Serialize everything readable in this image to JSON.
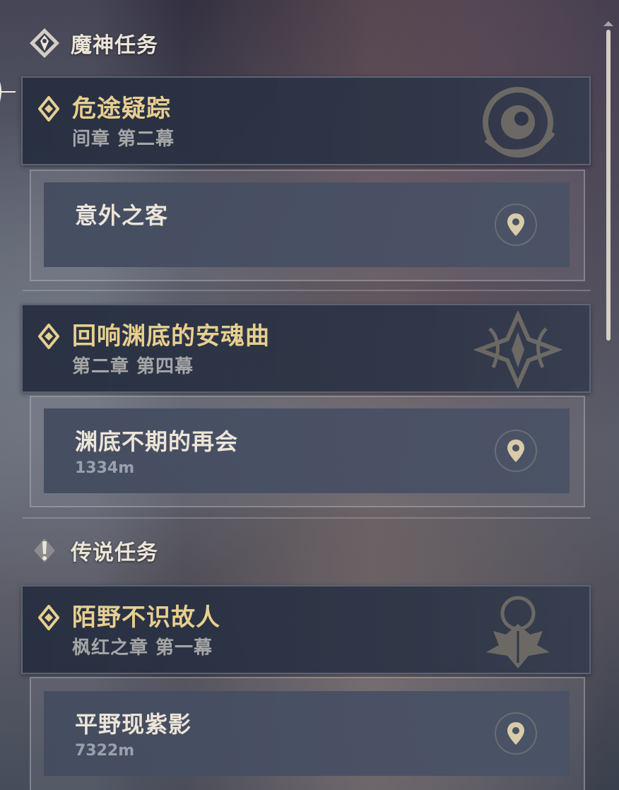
{
  "categories": [
    {
      "label": "魔神任务",
      "icon": "archon-quest-icon"
    },
    {
      "label": "传说任务",
      "icon": "story-quest-icon"
    }
  ],
  "quests": [
    {
      "title": "危途疑踪",
      "chapter": "间章 第二幕",
      "sub": {
        "name": "意外之客",
        "distance": ""
      }
    },
    {
      "title": "回响渊底的安魂曲",
      "chapter": "第二章 第四幕",
      "sub": {
        "name": "渊底不期的再会",
        "distance": "1334m"
      }
    },
    {
      "title": "陌野不识故人",
      "chapter": "枫红之章 第一幕",
      "sub": {
        "name": "平野现紫影",
        "distance": "7322m"
      }
    }
  ],
  "colors": {
    "gold": "#e8cf8f",
    "text": "#ece5d8",
    "muted": "#a6a6a6"
  }
}
